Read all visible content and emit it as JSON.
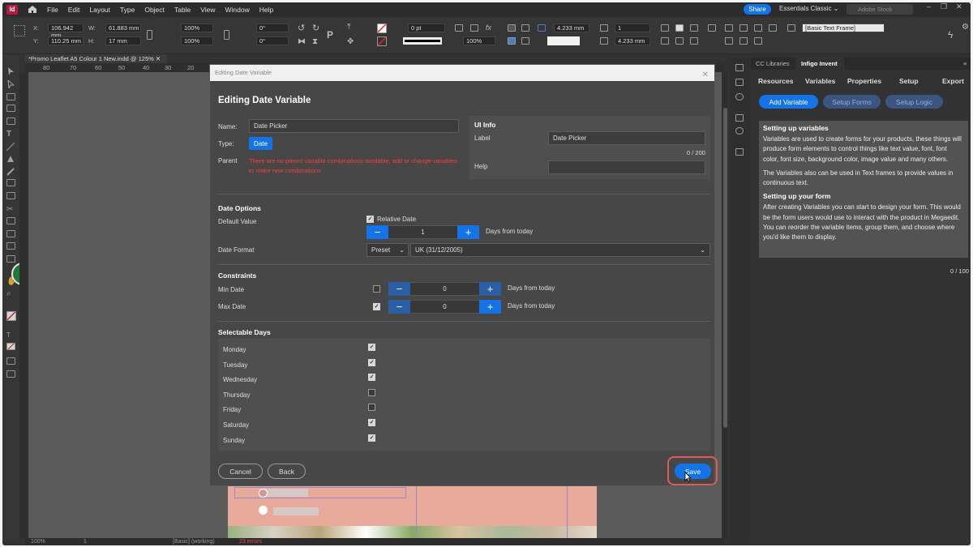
{
  "menubar": {
    "app_icon": "Id",
    "home": "home-icon",
    "items": [
      "File",
      "Edit",
      "Layout",
      "Type",
      "Object",
      "Table",
      "View",
      "Window",
      "Help"
    ],
    "share": "Share",
    "workspace": "Essentials Classic",
    "search_placeholder": "Adobe Stock"
  },
  "control": {
    "x_label": "X:",
    "x": "106.942 mm",
    "y_label": "Y:",
    "y": "110.25 mm",
    "w_label": "W:",
    "w": "61.883 mm",
    "h_label": "H:",
    "h": "17 mm",
    "scale_x": "100%",
    "scale_y": "100%",
    "rot": "0°",
    "shear": "0°",
    "stroke": "0 pt",
    "opacity": "100%",
    "inset1": "4.233 mm",
    "inset2": "4.233 mm",
    "cols": "1",
    "frame_style": "[Basic Text Frame]"
  },
  "document": {
    "tab": "*Promo Leaflet A5 Colour 1 New.indd @ 125%",
    "ruler": [
      "80",
      "70",
      "60",
      "50",
      "40",
      "30",
      "20"
    ]
  },
  "bottom": {
    "zoom": "100%",
    "page": "1",
    "style": "[Basic] (working)",
    "errors": "23 errors"
  },
  "panel": {
    "tabs": [
      "CC Libraries",
      "Infigo Invent"
    ],
    "nav": [
      "Resources",
      "Variables",
      "Properties",
      "Setup",
      "Export"
    ],
    "buttons": [
      "Add Variable",
      "Setup Forms",
      "Setup Logic"
    ],
    "h1": "Setting up variables",
    "p1": "Variables are used to create forms for your products, these things will produce form elements to control things like text value, font, font color, font size, background color, image value and many others.",
    "p2": "The Variables also can be used in Text frames to provide values in continuous text.",
    "h2": "Setting up your form",
    "p3": "After creating Variables you can start to design your form. This would be the form users would use to interact with the product in Megaedit. You can reorder the variable items, group them, and choose where you'd like them to display.",
    "counter": "0 / 100"
  },
  "dialog": {
    "titlebar": "Editing Date Variable",
    "heading": "Editing Date Variable",
    "name_label": "Name:",
    "name_value": "Date Picker",
    "type_label": "Type:",
    "type_value": "Date",
    "parent_label": "Parent",
    "parent_msg": "There are no parent variable combinations available, add or change variables to make new combinations",
    "ui_info": "UI Info",
    "label_label": "Label",
    "label_value": "Date Picker",
    "label_counter": "0 / 200",
    "help_label": "Help",
    "date_options": "Date Options",
    "default_value_label": "Default Value",
    "relative_date": "Relative Date",
    "default_value": "1",
    "days_from_today": "Days from today",
    "date_format_label": "Date Format",
    "format_preset": "Preset",
    "format_value": "UK (31/12/2005)",
    "constraints": "Constraints",
    "min_date": "Min Date",
    "min_value": "0",
    "max_date": "Max Date",
    "max_value": "0",
    "selectable_days": "Selectable Days",
    "days": [
      {
        "name": "Monday",
        "checked": true
      },
      {
        "name": "Tuesday",
        "checked": true
      },
      {
        "name": "Wednesday",
        "checked": true
      },
      {
        "name": "Thursday",
        "checked": false
      },
      {
        "name": "Friday",
        "checked": false
      },
      {
        "name": "Saturday",
        "checked": true
      },
      {
        "name": "Sunday",
        "checked": true
      }
    ],
    "cancel": "Cancel",
    "back": "Back",
    "save": "Save"
  },
  "colors": {
    "accent": "#1473e6",
    "error": "#ff3b3b",
    "highlight": "#e05a56",
    "panel": "#323232",
    "dialog": "#474747"
  }
}
